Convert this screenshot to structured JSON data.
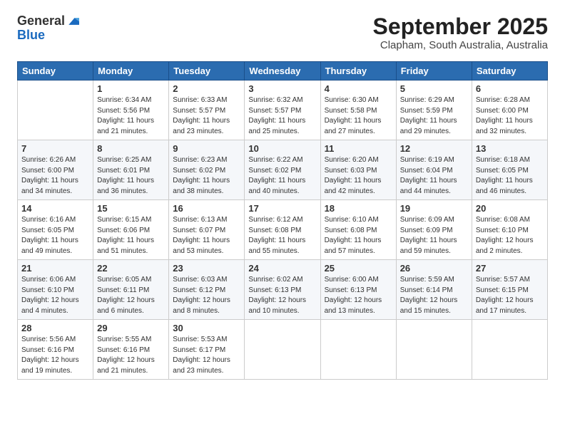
{
  "logo": {
    "general": "General",
    "blue": "Blue"
  },
  "title": "September 2025",
  "subtitle": "Clapham, South Australia, Australia",
  "days": [
    "Sunday",
    "Monday",
    "Tuesday",
    "Wednesday",
    "Thursday",
    "Friday",
    "Saturday"
  ],
  "weeks": [
    [
      {
        "day": "",
        "info": ""
      },
      {
        "day": "1",
        "info": "Sunrise: 6:34 AM\nSunset: 5:56 PM\nDaylight: 11 hours\nand 21 minutes."
      },
      {
        "day": "2",
        "info": "Sunrise: 6:33 AM\nSunset: 5:57 PM\nDaylight: 11 hours\nand 23 minutes."
      },
      {
        "day": "3",
        "info": "Sunrise: 6:32 AM\nSunset: 5:57 PM\nDaylight: 11 hours\nand 25 minutes."
      },
      {
        "day": "4",
        "info": "Sunrise: 6:30 AM\nSunset: 5:58 PM\nDaylight: 11 hours\nand 27 minutes."
      },
      {
        "day": "5",
        "info": "Sunrise: 6:29 AM\nSunset: 5:59 PM\nDaylight: 11 hours\nand 29 minutes."
      },
      {
        "day": "6",
        "info": "Sunrise: 6:28 AM\nSunset: 6:00 PM\nDaylight: 11 hours\nand 32 minutes."
      }
    ],
    [
      {
        "day": "7",
        "info": "Sunrise: 6:26 AM\nSunset: 6:00 PM\nDaylight: 11 hours\nand 34 minutes."
      },
      {
        "day": "8",
        "info": "Sunrise: 6:25 AM\nSunset: 6:01 PM\nDaylight: 11 hours\nand 36 minutes."
      },
      {
        "day": "9",
        "info": "Sunrise: 6:23 AM\nSunset: 6:02 PM\nDaylight: 11 hours\nand 38 minutes."
      },
      {
        "day": "10",
        "info": "Sunrise: 6:22 AM\nSunset: 6:02 PM\nDaylight: 11 hours\nand 40 minutes."
      },
      {
        "day": "11",
        "info": "Sunrise: 6:20 AM\nSunset: 6:03 PM\nDaylight: 11 hours\nand 42 minutes."
      },
      {
        "day": "12",
        "info": "Sunrise: 6:19 AM\nSunset: 6:04 PM\nDaylight: 11 hours\nand 44 minutes."
      },
      {
        "day": "13",
        "info": "Sunrise: 6:18 AM\nSunset: 6:05 PM\nDaylight: 11 hours\nand 46 minutes."
      }
    ],
    [
      {
        "day": "14",
        "info": "Sunrise: 6:16 AM\nSunset: 6:05 PM\nDaylight: 11 hours\nand 49 minutes."
      },
      {
        "day": "15",
        "info": "Sunrise: 6:15 AM\nSunset: 6:06 PM\nDaylight: 11 hours\nand 51 minutes."
      },
      {
        "day": "16",
        "info": "Sunrise: 6:13 AM\nSunset: 6:07 PM\nDaylight: 11 hours\nand 53 minutes."
      },
      {
        "day": "17",
        "info": "Sunrise: 6:12 AM\nSunset: 6:08 PM\nDaylight: 11 hours\nand 55 minutes."
      },
      {
        "day": "18",
        "info": "Sunrise: 6:10 AM\nSunset: 6:08 PM\nDaylight: 11 hours\nand 57 minutes."
      },
      {
        "day": "19",
        "info": "Sunrise: 6:09 AM\nSunset: 6:09 PM\nDaylight: 11 hours\nand 59 minutes."
      },
      {
        "day": "20",
        "info": "Sunrise: 6:08 AM\nSunset: 6:10 PM\nDaylight: 12 hours\nand 2 minutes."
      }
    ],
    [
      {
        "day": "21",
        "info": "Sunrise: 6:06 AM\nSunset: 6:10 PM\nDaylight: 12 hours\nand 4 minutes."
      },
      {
        "day": "22",
        "info": "Sunrise: 6:05 AM\nSunset: 6:11 PM\nDaylight: 12 hours\nand 6 minutes."
      },
      {
        "day": "23",
        "info": "Sunrise: 6:03 AM\nSunset: 6:12 PM\nDaylight: 12 hours\nand 8 minutes."
      },
      {
        "day": "24",
        "info": "Sunrise: 6:02 AM\nSunset: 6:13 PM\nDaylight: 12 hours\nand 10 minutes."
      },
      {
        "day": "25",
        "info": "Sunrise: 6:00 AM\nSunset: 6:13 PM\nDaylight: 12 hours\nand 13 minutes."
      },
      {
        "day": "26",
        "info": "Sunrise: 5:59 AM\nSunset: 6:14 PM\nDaylight: 12 hours\nand 15 minutes."
      },
      {
        "day": "27",
        "info": "Sunrise: 5:57 AM\nSunset: 6:15 PM\nDaylight: 12 hours\nand 17 minutes."
      }
    ],
    [
      {
        "day": "28",
        "info": "Sunrise: 5:56 AM\nSunset: 6:16 PM\nDaylight: 12 hours\nand 19 minutes."
      },
      {
        "day": "29",
        "info": "Sunrise: 5:55 AM\nSunset: 6:16 PM\nDaylight: 12 hours\nand 21 minutes."
      },
      {
        "day": "30",
        "info": "Sunrise: 5:53 AM\nSunset: 6:17 PM\nDaylight: 12 hours\nand 23 minutes."
      },
      {
        "day": "",
        "info": ""
      },
      {
        "day": "",
        "info": ""
      },
      {
        "day": "",
        "info": ""
      },
      {
        "day": "",
        "info": ""
      }
    ]
  ]
}
